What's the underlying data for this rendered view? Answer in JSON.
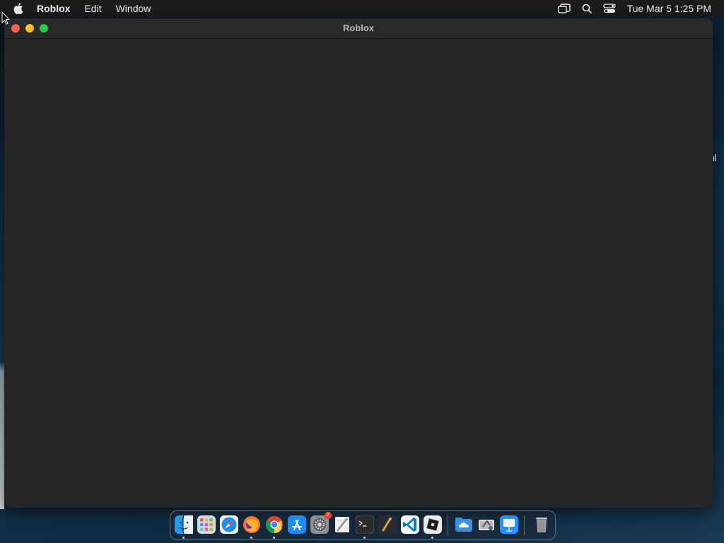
{
  "menubar": {
    "app_name": "Roblox",
    "items": [
      "Edit",
      "Window"
    ],
    "status_icons": [
      "screen-mirroring-icon",
      "spotlight-search-icon",
      "control-center-icon"
    ],
    "clock": "Tue Mar 5  1:25 PM"
  },
  "window": {
    "title": "Roblox"
  },
  "dock": {
    "apps": [
      {
        "name": "finder-icon",
        "running": true
      },
      {
        "name": "launchpad-icon",
        "running": false
      },
      {
        "name": "safari-icon",
        "running": false
      },
      {
        "name": "firefox-icon",
        "running": true
      },
      {
        "name": "chrome-icon",
        "running": true
      },
      {
        "name": "app-store-icon",
        "running": false
      },
      {
        "name": "system-settings-icon",
        "running": false,
        "badge": "2"
      },
      {
        "name": "script-editor-icon",
        "running": false
      },
      {
        "name": "terminal-icon",
        "running": true
      },
      {
        "name": "instruments-icon",
        "running": false
      },
      {
        "name": "vscode-icon",
        "running": false
      },
      {
        "name": "roblox-icon",
        "running": true
      },
      {
        "name": "cloud-folder-icon",
        "running": false
      },
      {
        "name": "disk-utility-icon",
        "running": false
      },
      {
        "name": "keynote-icon",
        "running": false
      },
      {
        "name": "trash-icon",
        "running": false
      }
    ]
  }
}
